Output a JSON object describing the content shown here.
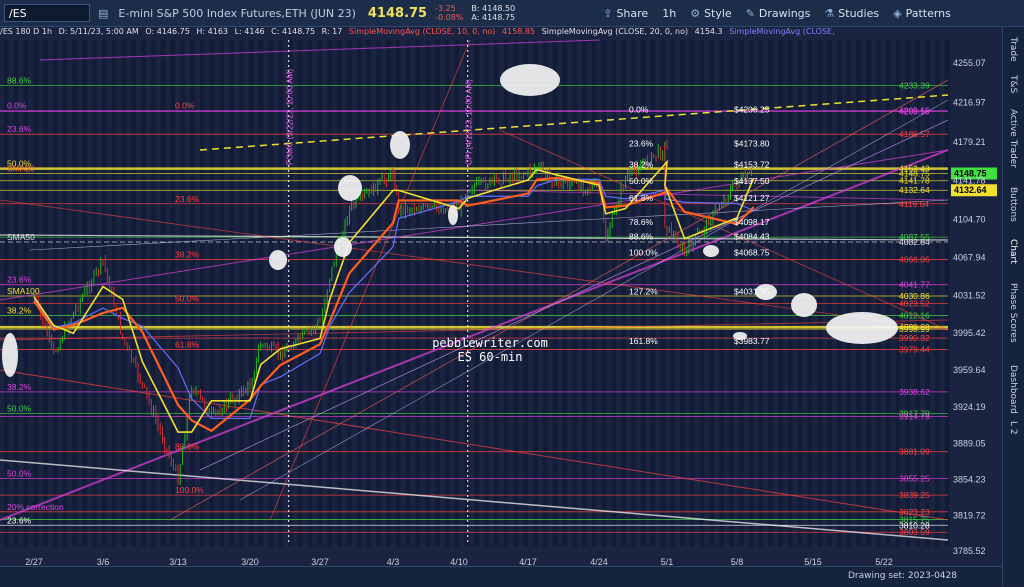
{
  "toolbar": {
    "symbol": "/ES",
    "description": "E-mini S&P 500 Index Futures,ETH (JUN 23)",
    "last": "4148.75",
    "change": "-3.25",
    "change_pct": "-0.08%",
    "bid": "B: 4148.50",
    "ask": "A: 4148.75",
    "share": "Share",
    "interval": "1h",
    "style": "Style",
    "drawings": "Drawings",
    "studies": "Studies",
    "patterns": "Patterns"
  },
  "infobar": {
    "symbol": "/ES 180 D 1h",
    "datetime": "D: 5/11/23, 5:00 AM",
    "open": "O: 4146.75",
    "high": "H: 4163",
    "low": "L: 4146",
    "close": "C: 4148.75",
    "range": "R: 17",
    "sma10": "SimpleMovingAvg (CLOSE, 10, 0, no)",
    "sma10_val": "4158.85",
    "sma20": "SimpleMovingAvg (CLOSE, 20, 0, no)",
    "sma20_val": "4154.3",
    "sma50": "SimpleMovingAvg (CLOSE,"
  },
  "sidebar": [
    "Trade",
    "T&S",
    "Active Trader",
    "Buttons",
    "Chart",
    "Phase Scores",
    "Dashboard",
    "L 2"
  ],
  "footer": {
    "drawing_set": "Drawing set: 2023-0428"
  },
  "watermark": {
    "site": "pebblewriter.com",
    "chart": "ES 60-min"
  },
  "colors": {
    "bg": "#1a2440",
    "up": "#20c020",
    "down": "#e03030",
    "sma10": "#f0e030",
    "sma20": "#ff6020",
    "fib": "#ff4040",
    "magenta": "#e040e0",
    "price_tag": "#f0e030"
  },
  "chart_data": {
    "type": "line",
    "title": "",
    "instrument": "/ES E-mini S&P 500 Index Futures (JUN 23), 1h",
    "x_ticks": [
      "2/27",
      "3/6",
      "3/13",
      "3/20",
      "3/27",
      "4/3",
      "4/10",
      "4/17",
      "4/24",
      "5/1",
      "5/8",
      "5/15",
      "5/22"
    ],
    "y_ticks": [
      4255.07,
      4216.97,
      4179.21,
      4141.78,
      4104.7,
      4067.94,
      4031.52,
      3995.42,
      3959.64,
      3924.19,
      3889.05,
      3854.23,
      3819.72,
      3785.52
    ],
    "ylim": [
      3785.52,
      4255.07
    ],
    "price_approx": {
      "x": [
        "2/27",
        "3/1",
        "3/3",
        "3/6",
        "3/8",
        "3/10",
        "3/13",
        "3/15",
        "3/17",
        "3/20",
        "3/22",
        "3/24",
        "3/27",
        "3/29",
        "3/31",
        "4/3",
        "4/5",
        "4/10",
        "4/12",
        "4/17",
        "4/19",
        "4/21",
        "4/24",
        "4/26",
        "4/28",
        "5/1",
        "5/2",
        "5/4",
        "5/8",
        "5/11"
      ],
      "values": [
        4030,
        3975,
        4015,
        4065,
        3990,
        3945,
        3855,
        3945,
        3915,
        3945,
        3985,
        3975,
        4005,
        4050,
        4115,
        4150,
        4115,
        4115,
        4135,
        4150,
        4155,
        4140,
        4135,
        4085,
        4145,
        4175,
        4100,
        4072,
        4140,
        4148.75
      ]
    },
    "series": [
      {
        "name": "SimpleMovingAvg (CLOSE, 10, 0, no)",
        "last": 4158.85
      },
      {
        "name": "SimpleMovingAvg (CLOSE, 20, 0, no)",
        "last": 4154.3
      }
    ],
    "right_labels": [
      4233.39,
      4209.15,
      4208.5,
      4186.57,
      4153.43,
      4148.75,
      4141.78,
      4132.64,
      4119.64,
      4087.55,
      4082.84,
      4066.06,
      4041.77,
      4030.86,
      4023.52,
      4012.16,
      4000.89,
      3998.99,
      3990.32,
      3979.44,
      3938.62,
      3917.79,
      3914.79,
      3881.09,
      3855.25,
      3839.25,
      3823.23,
      3815.75,
      3810.28,
      3803.59
    ],
    "fib_retrace": [
      {
        "label": "0.0%",
        "value": 4206.25
      },
      {
        "label": "23.6%",
        "value": 4173.8
      },
      {
        "label": "38.2%",
        "value": 4153.72
      },
      {
        "label": "50.0%",
        "value": 4137.5
      },
      {
        "label": "61.8%",
        "value": 4121.27
      },
      {
        "label": "78.6%",
        "value": 4098.17
      },
      {
        "label": "88.6%",
        "value": 4084.43
      },
      {
        "label": "100.0%",
        "value": 4068.75
      },
      {
        "label": "127.2%",
        "value": 4031.35
      },
      {
        "label": "161.8%",
        "value": 3983.77
      }
    ],
    "left_labels": [
      {
        "text": "88.6%",
        "value": 4233.39,
        "color": "#40d040"
      },
      {
        "text": "0.0%",
        "value": 4209.15,
        "color": "#e040e0"
      },
      {
        "text": "23.6%",
        "value": 4186.57,
        "color": "#e040e0"
      },
      {
        "text": "50.0%",
        "value": 4153.43,
        "color": "#f0e030"
      },
      {
        "text": "SMA20",
        "value": 4148.75,
        "color": "#ff6020"
      },
      {
        "text": "SMA50",
        "value": 4082.84,
        "color": "#e0e0e0"
      },
      {
        "text": "23.6%",
        "value": 4041.77,
        "color": "#e040e0"
      },
      {
        "text": "SMA100",
        "value": 4030.86,
        "color": "#f0e030"
      },
      {
        "text": "38.2%",
        "value": 4012.16,
        "color": "#f0e030"
      },
      {
        "text": "38.2%",
        "value": 3938.62,
        "color": "#e040e0"
      },
      {
        "text": "50.0%",
        "value": 3917.79,
        "color": "#40d040"
      },
      {
        "text": "50.0%",
        "value": 3855.25,
        "color": "#e040e0"
      },
      {
        "text": "20% correction",
        "value": 3823.23,
        "color": "#e040e0"
      },
      {
        "text": "23.6%",
        "value": 3810.28,
        "color": "#ffffff"
      }
    ],
    "mid_labels": [
      {
        "text": "0.0%",
        "value": 4209.15,
        "color": "#ff4040"
      },
      {
        "text": "23.6%",
        "value": 4119.64,
        "color": "#ff4040"
      },
      {
        "text": "38.2%",
        "value": 4066.06,
        "color": "#ff4040"
      },
      {
        "text": "50.0%",
        "value": 4023.52,
        "color": "#ff4040"
      },
      {
        "text": "61.8%",
        "value": 3979.44,
        "color": "#ff4040"
      },
      {
        "text": "88.6%",
        "value": 3881.09,
        "color": "#ff4040"
      },
      {
        "text": "100.0%",
        "value": 3839.25,
        "color": "#ff4040"
      }
    ],
    "annotations": [
      {
        "text": "FOMC (3/22/23, 10:00 AM)",
        "x": "3/22"
      },
      {
        "text": "CPI (4/12/23, 10:00 AM)",
        "x": "4/12"
      }
    ]
  }
}
